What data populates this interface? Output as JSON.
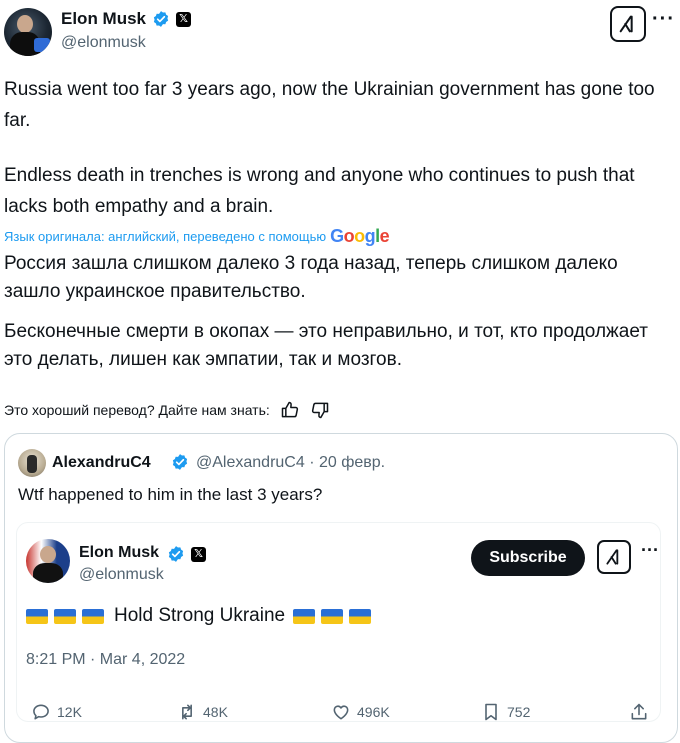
{
  "post": {
    "author_name": "Elon Musk",
    "handle": "@elonmusk",
    "text_en_1": "Russia went too far 3 years ago, now the Ukrainian government has gone too far.",
    "text_en_2": "Endless death in trenches is wrong and anyone who continues to push that lacks both empathy and a brain.",
    "translation_note": "Язык оригинала: английский, переведено с помощью",
    "translation_provider": "Google",
    "text_ru_1": "Россия зашла слишком далеко 3 года назад, теперь слишком далеко зашло украинское правительство.",
    "text_ru_2": "Бесконечные смерти в окопах — это неправильно, и тот, кто продолжает это делать, лишен как эмпатии, так и мозгов.",
    "feedback_prompt": "Это хороший перевод? Дайте нам знать:"
  },
  "quote": {
    "author_name": "AlexandruC4",
    "meta": "@AlexandruC4 · 20 февр.",
    "text": "Wtf happened to him in the last 3 years?"
  },
  "inner": {
    "author_name": "Elon Musk",
    "handle": "@elonmusk",
    "subscribe_label": "Subscribe",
    "text": "Hold Strong Ukraine",
    "timestamp": "8:21 PM · Mar 4, 2022",
    "replies": "12K",
    "reposts": "48K",
    "likes": "496K",
    "bookmarks": "752"
  },
  "icons": {
    "verified": "verified-badge-icon",
    "x_logo": "x-logo-icon",
    "grok": "grok-icon",
    "more": "more-icon",
    "thumbs_up": "thumbs-up-icon",
    "thumbs_down": "thumbs-down-icon",
    "reply": "reply-icon",
    "repost": "repost-icon",
    "like": "heart-icon",
    "bookmark": "bookmark-icon",
    "share": "share-icon"
  },
  "colors": {
    "verified_blue": "#1d9bf0",
    "text": "#0f1419",
    "muted": "#536471",
    "link": "#1d9bf0"
  }
}
